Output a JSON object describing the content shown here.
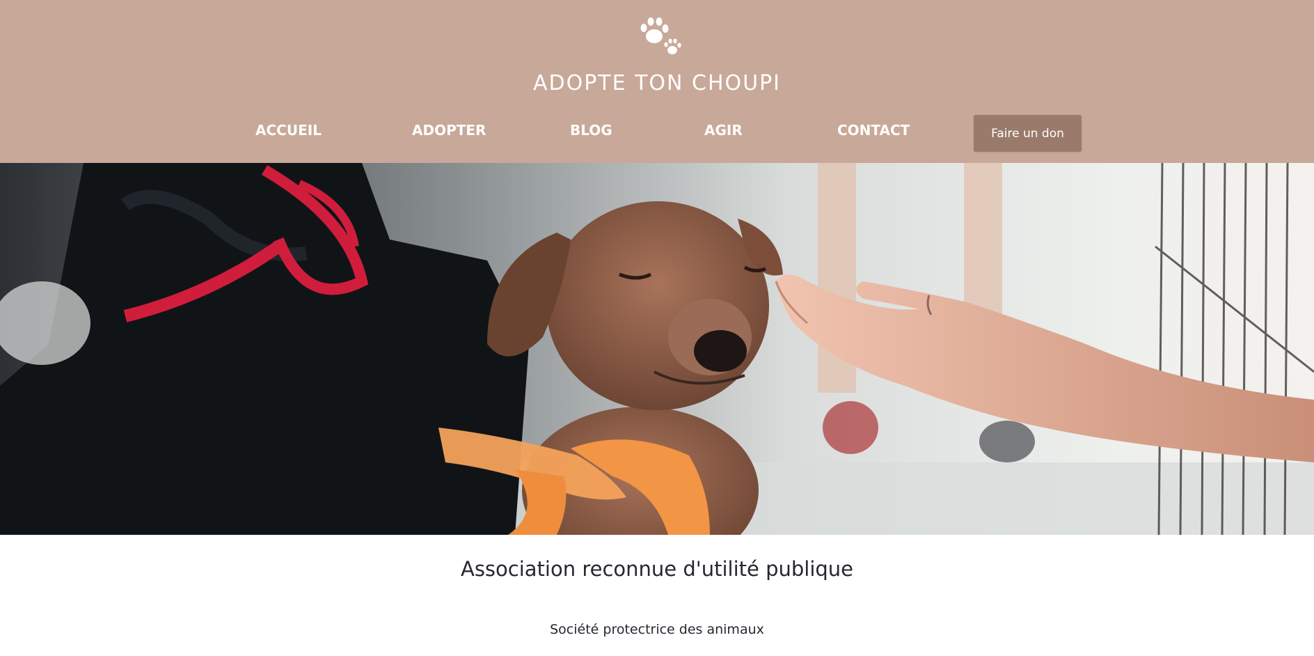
{
  "brand": {
    "logo_icon": "paw-prints-icon",
    "title": "ADOPTE TON CHOUPI",
    "header_color": "#c8a898",
    "button_color": "#9a7a6a"
  },
  "nav": {
    "items": [
      {
        "label": "ACCUEIL"
      },
      {
        "label": "ADOPTER"
      },
      {
        "label": "BLOG"
      },
      {
        "label": "AGIR"
      },
      {
        "label": "CONTACT"
      }
    ],
    "donate_label": "Faire un don"
  },
  "hero": {
    "image": "photo-puppy-petted-by-hand"
  },
  "intro": {
    "heading": "Association reconnue d'utilité publique",
    "subheading": "Société protectrice des animaux"
  }
}
